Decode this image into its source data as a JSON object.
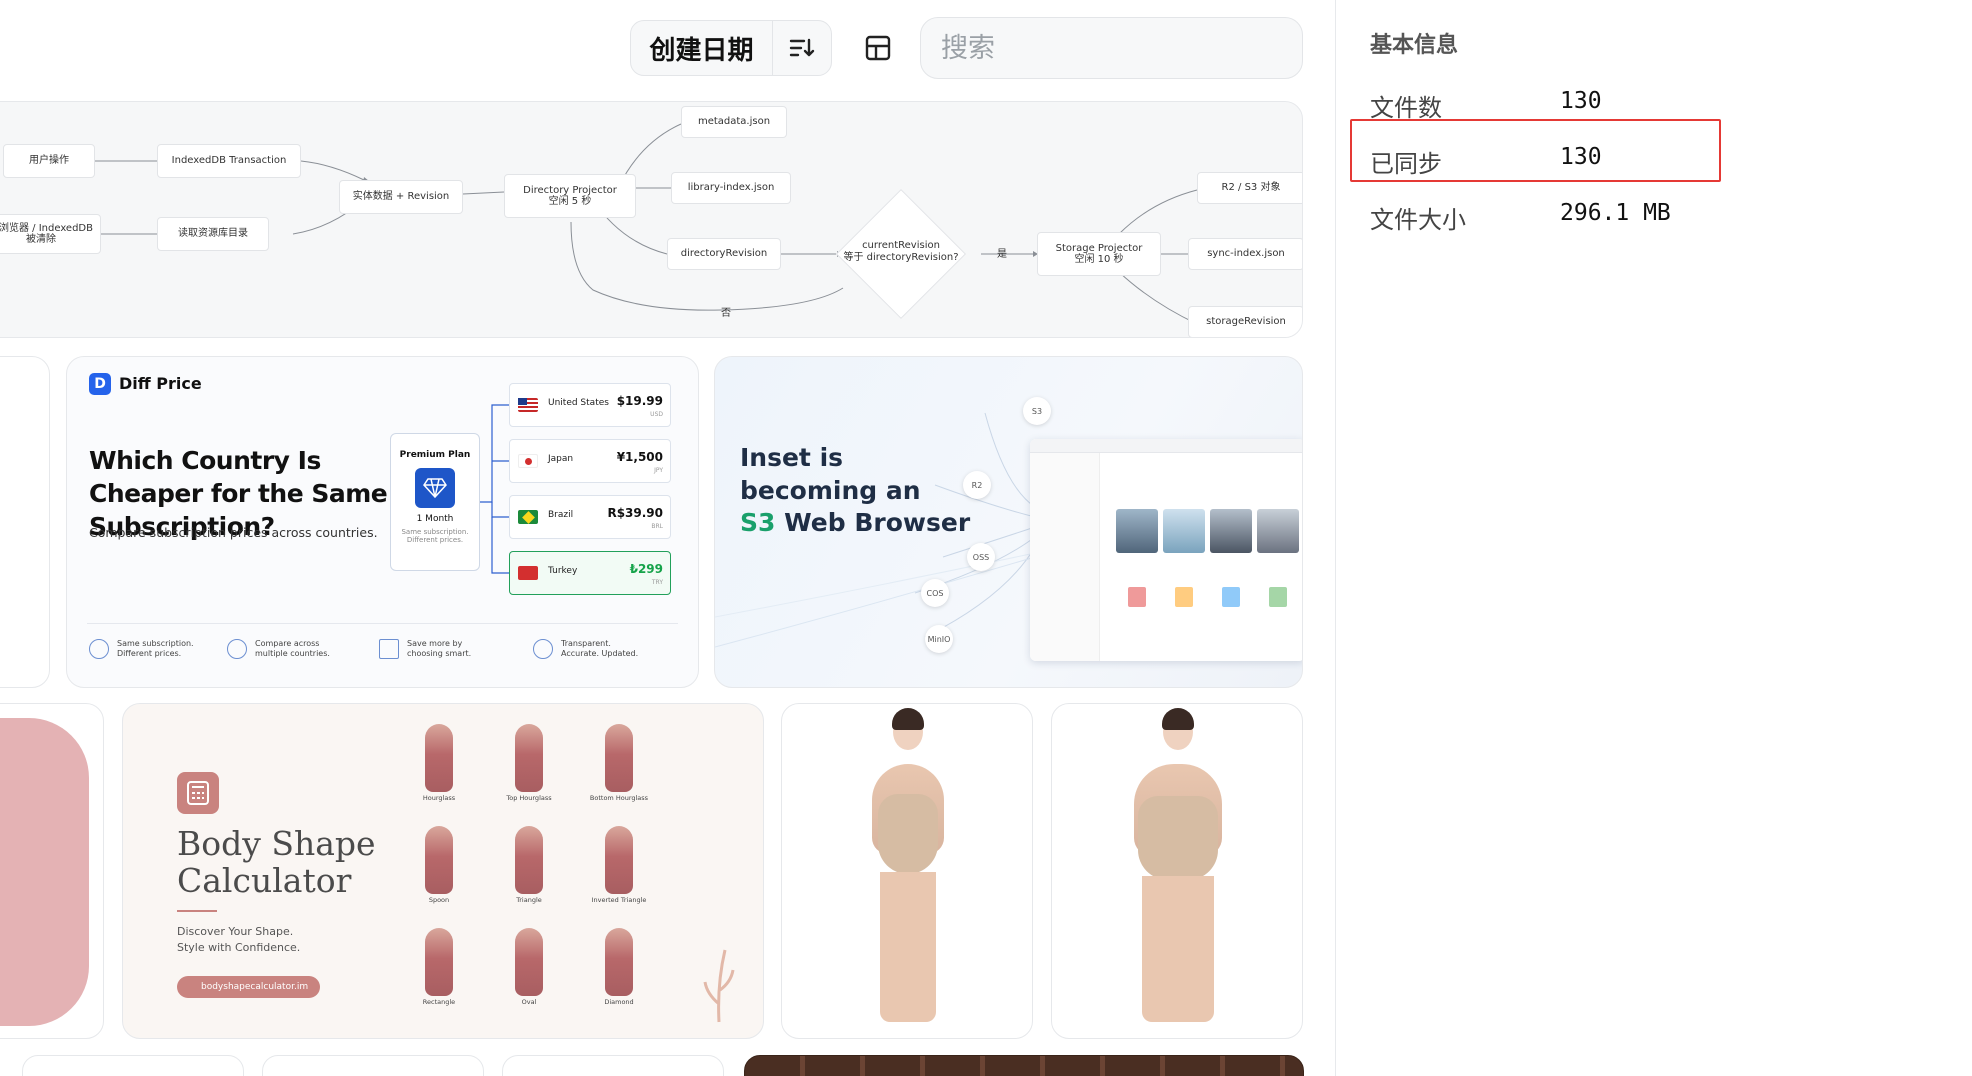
{
  "toolbar": {
    "sort_label": "创建日期",
    "search_placeholder": "搜索",
    "sort_direction_icon": "sort-descending-icon",
    "layout_icon": "layout-grid-icon"
  },
  "flow": {
    "nodes": {
      "user_action": "用户操作",
      "idb_tx": "IndexedDB Transaction",
      "browser_cleared": "新浏览器 / IndexedDB\n被清除",
      "read_library": "读取资源库目录",
      "entity_revision": "实体数据 + Revision",
      "dir_projector": "Directory Projector\n空闲 5 秒",
      "metadata": "metadata.json",
      "library_index": "library-index.json",
      "dir_revision": "directoryRevision",
      "decision": "currentRevision\n等于 directoryRevision?",
      "storage_projector": "Storage Projector\n空闲 10 秒",
      "r2s3": "R2 / S3 对象",
      "sync_index": "sync-index.json",
      "storage_revision": "storageRevision"
    },
    "edge_yes": "是",
    "edge_no": "否"
  },
  "diff_card": {
    "logo_letter": "D",
    "brand": "Diff Price",
    "title": "Which Country Is Cheaper for the Same Subscription?",
    "subtitle": "Compare subscription prices across countries.",
    "plan_title": "Premium Plan",
    "plan_period": "1 Month",
    "plan_note": "Same subscription.\nDifferent prices.",
    "countries": [
      {
        "name": "United States",
        "price": "$19.99",
        "currency": "USD"
      },
      {
        "name": "Japan",
        "price": "¥1,500",
        "currency": "JPY"
      },
      {
        "name": "Brazil",
        "price": "R$39.90",
        "currency": "BRL"
      },
      {
        "name": "Turkey",
        "price": "₺299",
        "currency": "TRY"
      }
    ],
    "features": [
      "Same subscription.\nDifferent prices.",
      "Compare across\nmultiple countries.",
      "Save more by\nchoosing smart.",
      "Transparent.\nAccurate. Updated."
    ]
  },
  "s3_card": {
    "title_line1": "Inset is",
    "title_line2": "becoming an",
    "title_hl": "S3",
    "title_line3": " Web Browser",
    "providers": [
      "S3",
      "R2",
      "OSS",
      "COS",
      "MinIO"
    ]
  },
  "body_card": {
    "title_line1": "Body Shape",
    "title_line2": "Calculator",
    "subtitle_line1": "Discover Your Shape.",
    "subtitle_line2": "Style with Confidence.",
    "url": "bodyshapecalculator.im",
    "shapes": [
      "Hourglass",
      "Top Hourglass",
      "Bottom Hourglass",
      "Spoon",
      "Triangle",
      "Inverted Triangle",
      "Rectangle",
      "Oval",
      "Diamond"
    ]
  },
  "info": {
    "title": "基本信息",
    "rows": [
      {
        "label": "文件数",
        "value": "130"
      },
      {
        "label": "已同步",
        "value": "130"
      },
      {
        "label": "文件大小",
        "value": "296.1 MB"
      }
    ]
  },
  "colors": {
    "highlight_box": "#e53935",
    "accent_blue": "#2563eb",
    "accent_green": "#16a34a",
    "body_accent": "#c9837f"
  }
}
